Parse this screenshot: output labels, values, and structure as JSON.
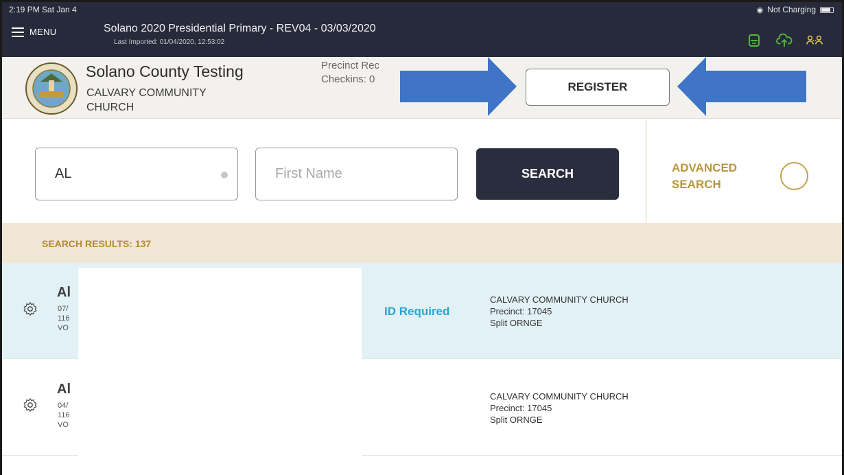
{
  "status_bar": {
    "time": "2:19 PM  Sat Jan 4",
    "battery_text": "Not Charging"
  },
  "app_bar": {
    "menu_label": "MENU",
    "title": "Solano 2020 Presidential Primary - REV04 - 03/03/2020",
    "subtitle": "Last Imported: 01/04/2020, 12:53:02",
    "icons": [
      "printer-icon",
      "cloud-upload-icon",
      "users-sync-icon"
    ],
    "icon_color": "#56b83a"
  },
  "header": {
    "county": "Solano County Testing",
    "site_line1": "CALVARY COMMUNITY",
    "site_line2": "CHURCH",
    "precinct_label": "Precinct Rec",
    "checkins_label": "Checkins:  0",
    "register_label": "REGISTER",
    "arrow_color": "#3f74c6"
  },
  "search": {
    "last_name_value": "AL",
    "first_name_placeholder": "First Name",
    "search_label": "SEARCH",
    "advanced_line1": "ADVANCED",
    "advanced_line2": "SEARCH"
  },
  "results": {
    "label": "SEARCH RESULTS: 137"
  },
  "rows": [
    {
      "name": "Al",
      "line1": "07/",
      "line2": "116",
      "line3": "VO",
      "status": "ID Required",
      "location": "CALVARY COMMUNITY CHURCH",
      "precinct": "Precinct: 17045",
      "split": "Split ORNGE"
    },
    {
      "name": "Al",
      "line1": "04/",
      "line2": "116",
      "line3": "VO",
      "status": "",
      "location": "CALVARY COMMUNITY CHURCH",
      "precinct": "Precinct: 17045",
      "split": "Split ORNGE"
    }
  ]
}
